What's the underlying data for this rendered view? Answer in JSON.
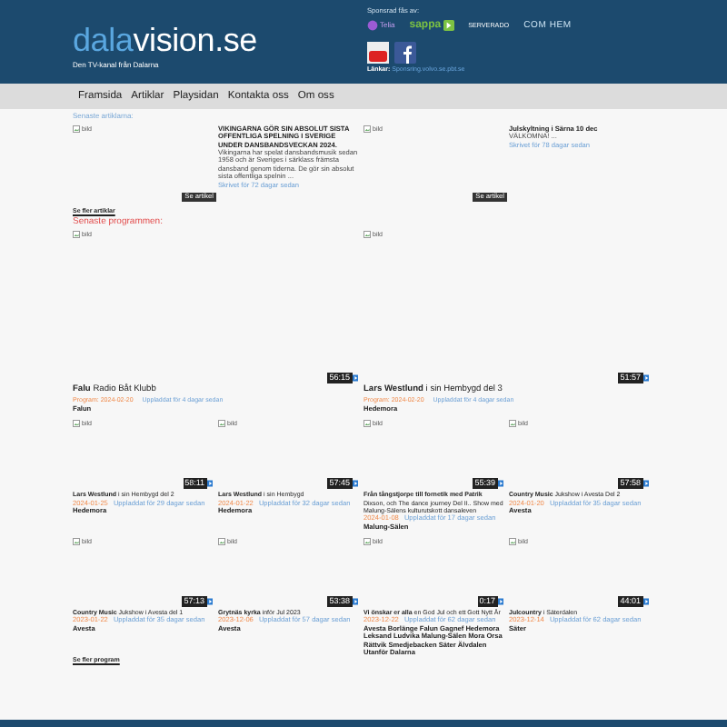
{
  "header": {
    "logo": {
      "part_1": "dala",
      "part_2": "vision",
      "part_3": ".se"
    },
    "tagline": "Den TV-kanal från Dalarna",
    "sponsor_label": "Sponsrad fås av:",
    "sponsors": [
      {
        "kind": "telia",
        "name": "Telia"
      },
      {
        "kind": "sappa",
        "name": "sappa"
      },
      {
        "kind": "serverado",
        "name": "SERVERADO"
      },
      {
        "kind": "comhem",
        "name": "COM HEM"
      }
    ],
    "links_label": "Länkar:",
    "link": "Sponsring.volvo.se.pbt.se"
  },
  "nav": [
    "Framsida",
    "Artiklar",
    "Playsidan",
    "Kontakta oss",
    "Om oss"
  ],
  "articles_heading": "Senaste artiklarna:",
  "articles": [
    {
      "image_alt": "bild",
      "title": "VIKINGARNA GÖR SIN ABSOLUT SISTA OFFENTLIGA SPELNING I SVERIGE UNDER DANSBANDSVECKAN 2024.",
      "excerpt": "Vikingarna har spelat dansbandsmusik sedan 1958 och är Sveriges i särklass främsta dansband genom tiderna. De gör sin absolut sista offentliga spelnin ...",
      "posted": "Skrivet för 72 dagar sedan",
      "button": "Se artikel"
    },
    {
      "image_alt": "bild",
      "title": "Julskyltning i Särna 10 dec",
      "excerpt": "VÄLKOMNA! ...",
      "posted": "Skrivet för 78 dagar sedan",
      "button": "Se artikel"
    }
  ],
  "more_articles": "Se fler artiklar",
  "programs_heading": "Senaste programmen:",
  "featured": [
    {
      "image_alt": "bild",
      "duration": "56:15",
      "title": "**Falu** Radio Båt Klubb",
      "date": "Program: 2024-02-20",
      "uploaded": "Uppladdat för 4 dagar sedan",
      "location": "Falun"
    },
    {
      "image_alt": "bild",
      "duration": "51:57",
      "title": "**Lars Westlund** i sin Hembygd del 3",
      "date": "Program: 2024-02-20",
      "uploaded": "Uppladdat för 4 dagar sedan",
      "location": "Hedemora"
    }
  ],
  "programs": [
    {
      "image_alt": "bild",
      "duration": "58:11",
      "title": "**Lars Westlund** i sin Hembygd del 2",
      "date": "2024-01-25",
      "uploaded": "Uppladdat för 29 dagar sedan",
      "location": "Hedemora"
    },
    {
      "image_alt": "bild",
      "duration": "57:45",
      "title": "**Lars Westlund** i sin Hembygd",
      "date": "2024-01-22",
      "uploaded": "Uppladdat för 32 dagar sedan",
      "location": "Hedemora"
    },
    {
      "image_alt": "bild",
      "duration": "55:39",
      "title": "**Från tångstjorpe till fornetik med Patrik** Dixson, och The dance journey Del II.. Show med Malung-Sälens kulturutskott dansaleven",
      "date": "2024-01-08",
      "uploaded": "Uppladdat för 17 dagar sedan",
      "location": "Malung-Sälen"
    },
    {
      "image_alt": "bild",
      "duration": "57:58",
      "title": "**Country Music** Jukshow i Avesta Del 2",
      "date": "2024-01-20",
      "uploaded": "Uppladdat för 35 dagar sedan",
      "location": "Avesta"
    },
    {
      "image_alt": "bild",
      "duration": "57:13",
      "title": "**Country Music** Jukshow i Avesta del 1",
      "date": "2023-01-22",
      "uploaded": "Uppladdat för 35 dagar sedan",
      "location": "Avesta"
    },
    {
      "image_alt": "bild",
      "duration": "53:38",
      "title": "**Grytnäs kyrka** inför Jul 2023",
      "date": "2023-12-06",
      "uploaded": "Uppladdat för 57 dagar sedan",
      "location": "Avesta"
    },
    {
      "image_alt": "bild",
      "duration": "0:17",
      "title": "**Vi önskar er alla** en God Jul och ett Gott Nytt År",
      "date": "2023-12-22",
      "uploaded": "Uppladdat för 62 dagar sedan",
      "location": "Avesta Borlänge Falun Gagnef Hedemora Leksand Ludvika Malung-Sälen Mora Orsa Rättvik Smedjebacken Säter Älvdalen Utanför Dalarna"
    },
    {
      "image_alt": "bild",
      "duration": "44:01",
      "title": "**Julcountry** i Säterdalen",
      "date": "2023-12-14",
      "uploaded": "Uppladdat för 62 dagar sedan",
      "location": "Säter"
    }
  ],
  "more_programs": "Se fler program"
}
